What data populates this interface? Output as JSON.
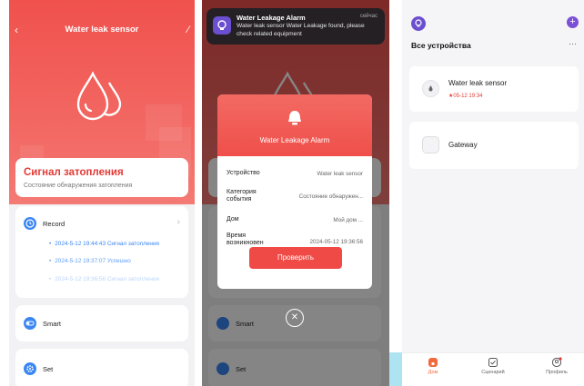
{
  "screen1": {
    "title": "Water leak sensor",
    "back_icon": "chevron-left-icon",
    "edit_icon": "edit-icon",
    "status": {
      "title": "Сигнал затопления",
      "subtitle": "Состояние обнаружения затопления"
    },
    "record": {
      "label": "Record",
      "items": [
        "2024-5-12 19:44:43 Сигнал затопления",
        "2024-5-12 19:37:07 Успешно",
        "2024-5-12 19:36:56 Сигнал затопления"
      ]
    },
    "smart_label": "Smart",
    "set_label": "Set"
  },
  "screen2": {
    "notification": {
      "title": "Water Leakage Alarm",
      "time": "сейчас",
      "body": "Water leak sensor Water Leakage found, please check related equipment"
    },
    "dialog": {
      "title": "Water Leakage Alarm",
      "rows": [
        {
          "key": "Устройство",
          "value": "Water leak sensor"
        },
        {
          "key": "Категория события",
          "value": "Состояние обнаружен..."
        },
        {
          "key": "Дом",
          "value": "Мой дом ..."
        },
        {
          "key": "Время возникновен",
          "value": "2024-05-12 19:36:56"
        }
      ],
      "button": "Проверить"
    },
    "smart_label": "Smart",
    "set_label": "Set"
  },
  "screen3": {
    "header_title": "Все устройства",
    "more": "···",
    "devices": [
      {
        "name": "Water leak sensor",
        "status": "05-12 19:34"
      },
      {
        "name": "Gateway"
      }
    ],
    "tabs": [
      "Дом",
      "Сценарий",
      "Профиль"
    ],
    "colors": {
      "accent": "#7b4fd6",
      "alert": "#e23a36",
      "brand_blue": "#3a86f2"
    }
  }
}
